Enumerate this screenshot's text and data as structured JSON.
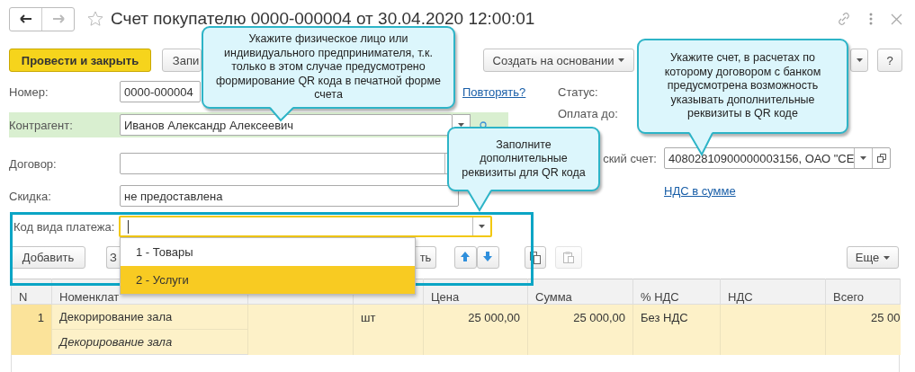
{
  "window": {
    "title": "Счет покупателю 0000-000004 от 30.04.2020 12:00:01",
    "favorite": false
  },
  "toolbar": [
    {
      "kind": "primary",
      "label": "Провести и закрыть"
    },
    {
      "kind": "plain",
      "label": "Запи"
    },
    {
      "kind": "menu",
      "label": "Создать на основании"
    },
    {
      "kind": "caret"
    },
    {
      "kind": "plain",
      "label": "?"
    }
  ],
  "fields": {
    "number": {
      "label": "Номер:",
      "value": "0000-000004"
    },
    "repeat_link": "Повторять?",
    "status": {
      "label": "Статус:"
    },
    "counterparty": {
      "label": "Контрагент:",
      "value": "Иванов Александр Алексеевич",
      "highlighted": true
    },
    "pay_until": {
      "label": "Оплата до:"
    },
    "contract": {
      "label": "Договор:"
    },
    "bank_account": {
      "label": "ский счет:",
      "value": "40802810900000003156, ОАО \"СЕ"
    },
    "discount": {
      "label": "Скидка:",
      "value": "не предоставлена"
    },
    "vat_link": "НДС в сумме",
    "payment_code": {
      "label": "Код вида платежа:",
      "focused": true
    }
  },
  "payment_code_options": [
    {
      "label": "1 - Товары",
      "selected": false
    },
    {
      "label": "2 - Услуги",
      "selected": true
    }
  ],
  "table_toolbar": [
    {
      "kind": "text",
      "label": "Добавить",
      "disabled": false
    },
    {
      "kind": "text",
      "label": "З",
      "disabled": false
    },
    {
      "kind": "text",
      "label": "ть",
      "disabled": false
    },
    {
      "kind": "up",
      "disabled": false
    },
    {
      "kind": "down",
      "disabled": false
    },
    {
      "kind": "copy",
      "disabled": false
    },
    {
      "kind": "paste",
      "disabled": true
    },
    {
      "kind": "menu",
      "label": "Еще",
      "disabled": false
    }
  ],
  "table": {
    "columns": [
      "N",
      "Номенклат",
      "Цена",
      "Сумма",
      "% НДС",
      "НДС",
      "Всего"
    ],
    "rows": [
      {
        "selected": true,
        "n": "1",
        "item": "Декорирование зала",
        "item_note": "Декорирование зала",
        "unit": "шт",
        "price": "25 000,00",
        "sum": "25 000,00",
        "vat_rate": "Без НДС",
        "total": "25 00"
      }
    ]
  },
  "callouts": [
    {
      "text": "Укажите физическое лицо или индивидуального предпринимателя, т.к. только в этом случае предусмотрено формирование QR кода в печатной форме счета"
    },
    {
      "text": "Заполните дополнительные реквизиты для QR кода"
    },
    {
      "text": "Укажите счет, в расчетах по которому договором с банком предусмотрена возможность указывать дополнительные реквизиты в QR коде"
    }
  ]
}
